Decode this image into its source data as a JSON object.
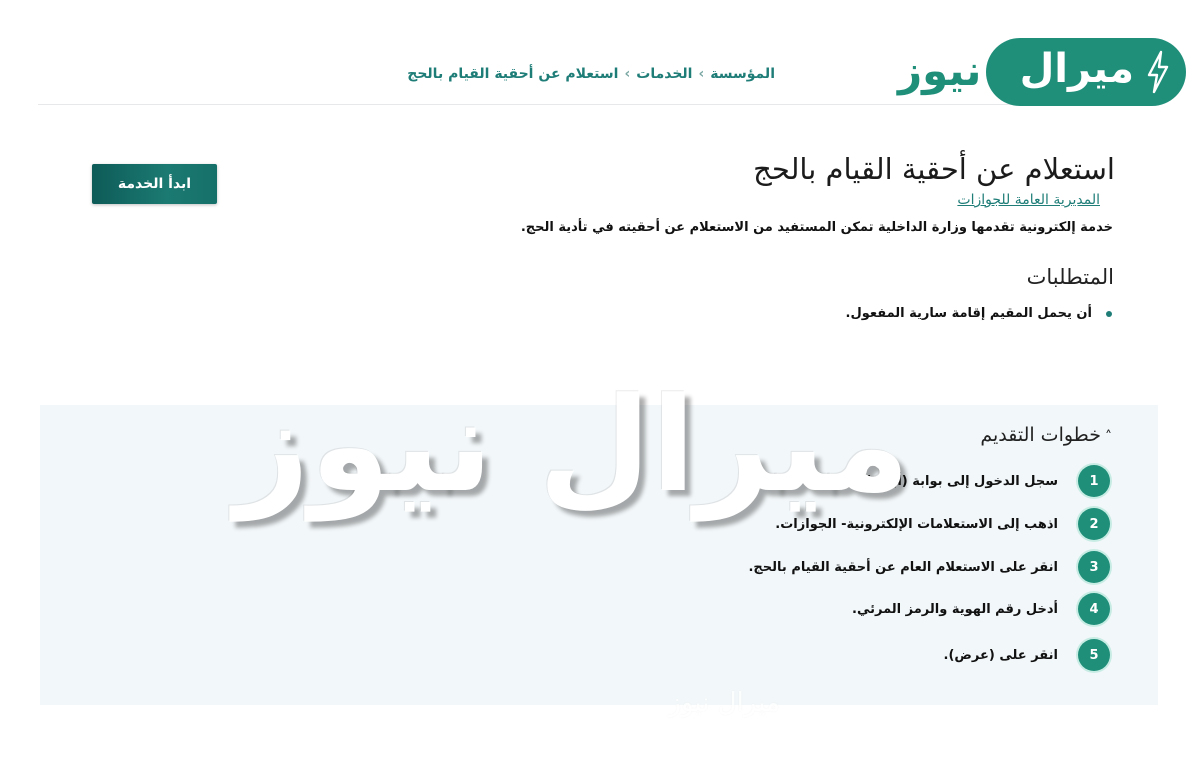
{
  "breadcrumb": {
    "items": [
      "المؤسسة",
      "الخدمات",
      "استعلام عن أحقية القيام بالحج"
    ]
  },
  "brand": {
    "pill_text": "ميرال",
    "outer_text": "نيوز",
    "accent": "#1f8f7a",
    "icon": "lightning-bolt-icon"
  },
  "service": {
    "title": "استعلام عن أحقية القيام بالحج",
    "agency": "المديرية العامة للجوازات",
    "description": "خدمة إلكترونية تقدمها وزارة الداخلية تمكن المستفيد من الاستعلام عن أحقيته في تأدية الحج.",
    "start_button": "ابدأ الخدمة"
  },
  "requirements": {
    "title": "المتطلبات",
    "items": [
      "أن يحمل المقيم إقامة سارية المفعول."
    ]
  },
  "steps": {
    "title": "خطوات التقديم",
    "items": [
      {
        "num": "1",
        "text": "سجل الدخول إلى بوابة (أبشر)."
      },
      {
        "num": "2",
        "text": "اذهب إلى الاستعلامات الإلكترونية- الجوازات."
      },
      {
        "num": "3",
        "text": "انقر على الاستعلام العام عن أحقية القيام بالحج."
      },
      {
        "num": "4",
        "text": "أدخل رقم الهوية والرمز المرئي."
      },
      {
        "num": "5",
        "text": "انقر على (عرض)."
      }
    ]
  },
  "watermark": {
    "text": "ميرال نيوز"
  }
}
